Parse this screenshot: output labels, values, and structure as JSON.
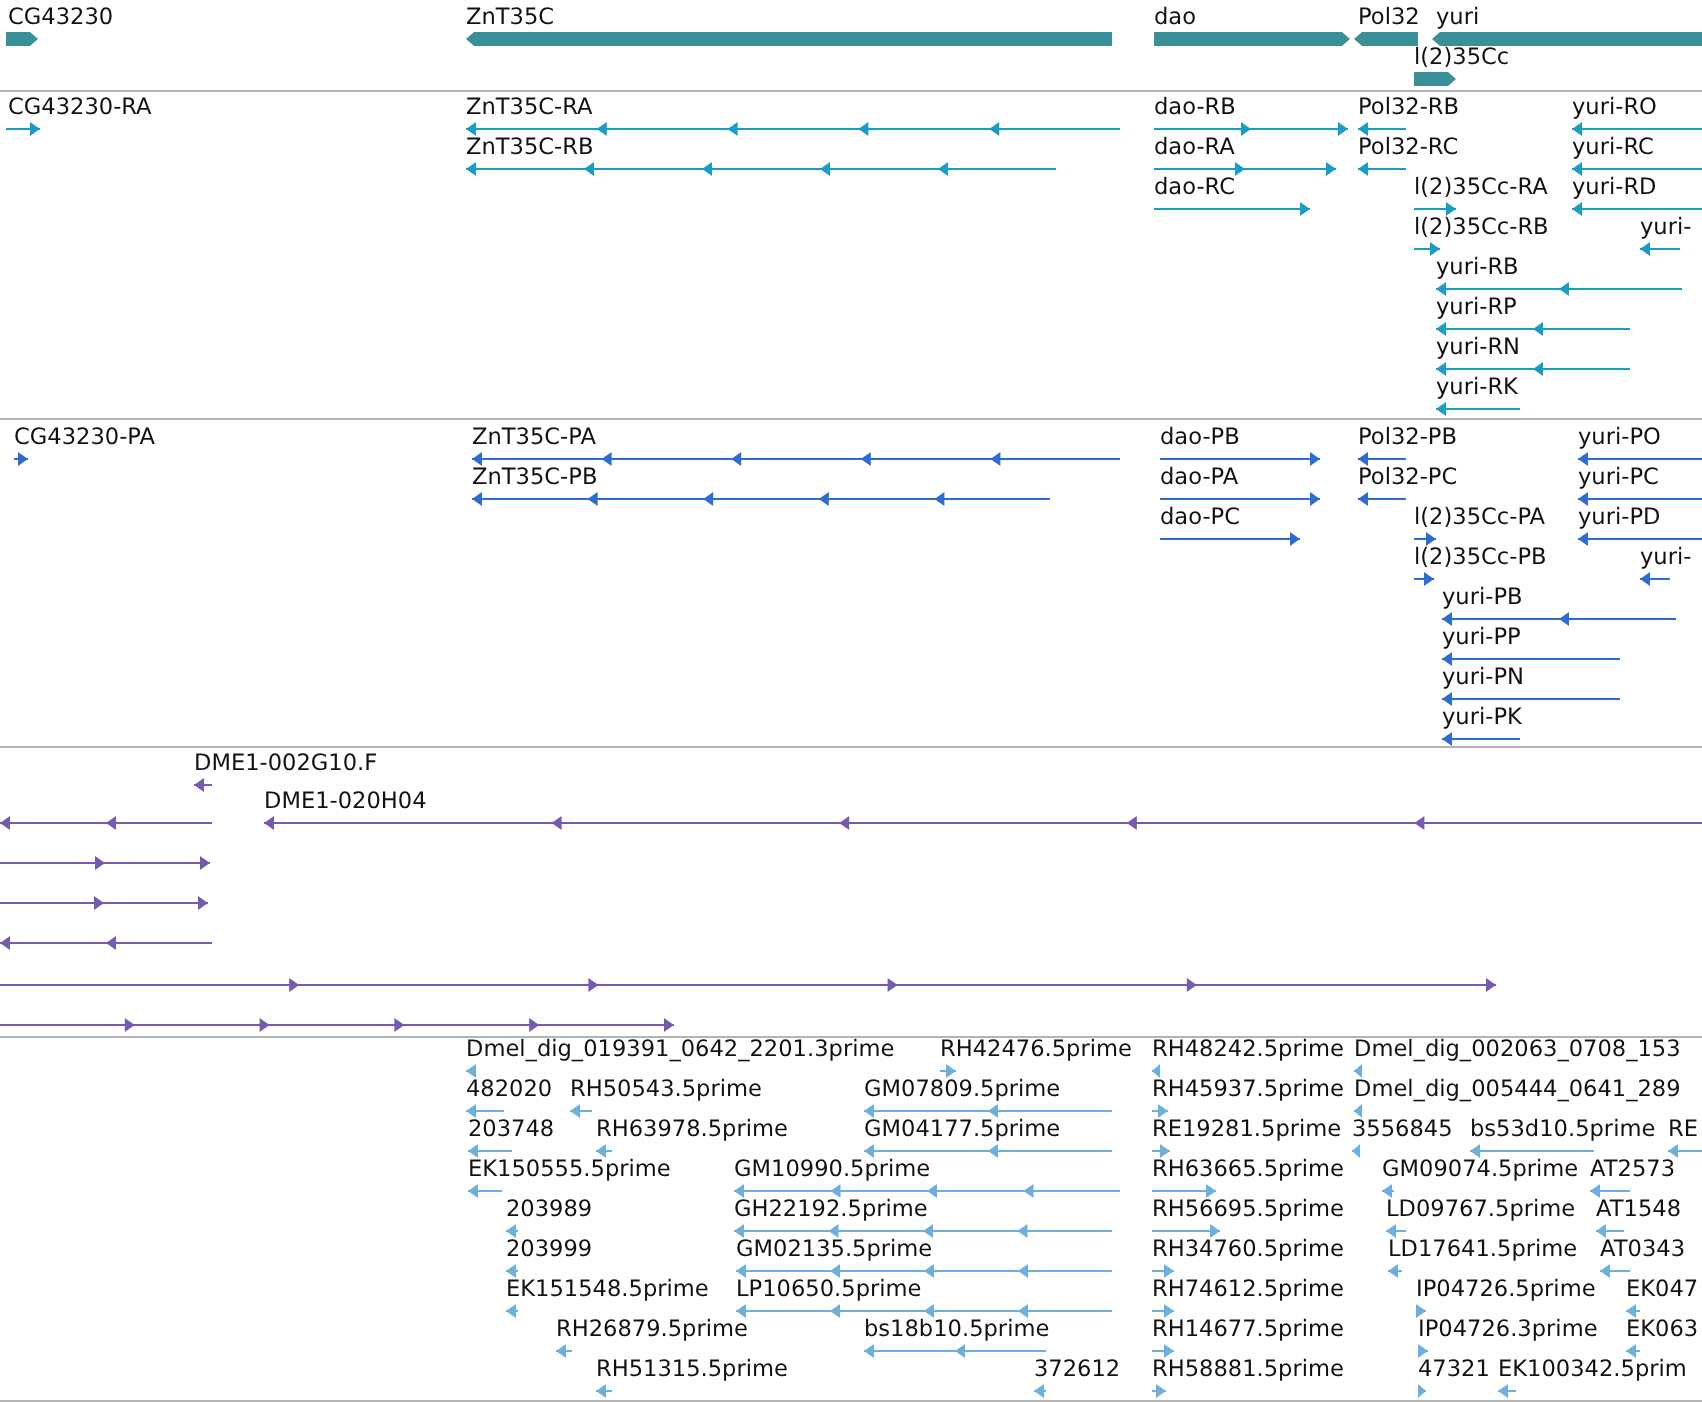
{
  "tracks": [
    {
      "kind": "gene",
      "color": "#3a9098",
      "features": [
        {
          "label": "CG43230",
          "reverse": false
        },
        {
          "label": "ZnT35C",
          "reverse": true
        },
        {
          "label": "dao",
          "reverse": false
        },
        {
          "label": "Pol32",
          "reverse": true
        },
        {
          "label": "yuri",
          "reverse": true
        },
        {
          "label": "l(2)35Cc",
          "reverse": false
        }
      ]
    },
    {
      "kind": "transcript",
      "color": "#1a9cc4",
      "features": [
        {
          "label": "CG43230-RA",
          "reverse": false
        },
        {
          "label": "ZnT35C-RA",
          "reverse": true
        },
        {
          "label": "ZnT35C-RB",
          "reverse": true
        },
        {
          "label": "dao-RB",
          "reverse": false
        },
        {
          "label": "dao-RA",
          "reverse": false
        },
        {
          "label": "dao-RC",
          "reverse": false
        },
        {
          "label": "Pol32-RB",
          "reverse": true
        },
        {
          "label": "Pol32-RC",
          "reverse": true
        },
        {
          "label": "l(2)35Cc-RA",
          "reverse": false
        },
        {
          "label": "l(2)35Cc-RB",
          "reverse": false
        },
        {
          "label": "yuri-RO",
          "reverse": true
        },
        {
          "label": "yuri-RC",
          "reverse": true
        },
        {
          "label": "yuri-RD",
          "reverse": true
        },
        {
          "label": "yuri-",
          "reverse": true
        },
        {
          "label": "yuri-RB",
          "reverse": true
        },
        {
          "label": "yuri-RP",
          "reverse": true
        },
        {
          "label": "yuri-RN",
          "reverse": true
        },
        {
          "label": "yuri-RK",
          "reverse": true
        }
      ]
    },
    {
      "kind": "protein",
      "color": "#2e6cd4",
      "features": [
        {
          "label": "CG43230-PA",
          "reverse": false
        },
        {
          "label": "ZnT35C-PA",
          "reverse": true
        },
        {
          "label": "ZnT35C-PB",
          "reverse": true
        },
        {
          "label": "dao-PB",
          "reverse": false
        },
        {
          "label": "dao-PA",
          "reverse": false
        },
        {
          "label": "dao-PC",
          "reverse": false
        },
        {
          "label": "Pol32-PB",
          "reverse": true
        },
        {
          "label": "Pol32-PC",
          "reverse": true
        },
        {
          "label": "l(2)35Cc-PA",
          "reverse": false
        },
        {
          "label": "l(2)35Cc-PB",
          "reverse": false
        },
        {
          "label": "yuri-PO",
          "reverse": true
        },
        {
          "label": "yuri-PC",
          "reverse": true
        },
        {
          "label": "yuri-PD",
          "reverse": true
        },
        {
          "label": "yuri-",
          "reverse": true
        },
        {
          "label": "yuri-PB",
          "reverse": true
        },
        {
          "label": "yuri-PP",
          "reverse": true
        },
        {
          "label": "yuri-PN",
          "reverse": true
        },
        {
          "label": "yuri-PK",
          "reverse": true
        }
      ]
    },
    {
      "kind": "clone",
      "color": "#7659b0",
      "features": [
        {
          "label": "DME1-002G10.F",
          "reverse": true
        },
        {
          "label": "DME1-020H04",
          "reverse": true
        },
        {
          "reverse": true
        },
        {
          "reverse": false
        },
        {
          "reverse": false
        },
        {
          "reverse": true
        },
        {
          "reverse": false
        },
        {
          "reverse": false
        }
      ]
    },
    {
      "kind": "est",
      "color": "#6cb0e0",
      "features": [
        {
          "label": "Dmel_dig_019391_0642_2201.3prime",
          "reverse": true
        },
        {
          "label": "RH42476.5prime",
          "reverse": false
        },
        {
          "label": "RH48242.5prime",
          "reverse": true
        },
        {
          "label": "Dmel_dig_002063_0708_153",
          "reverse": true
        },
        {
          "label": "482020",
          "reverse": true
        },
        {
          "label": "RH50543.5prime",
          "reverse": true
        },
        {
          "label": "GM07809.5prime",
          "reverse": true
        },
        {
          "label": "RH45937.5prime",
          "reverse": false
        },
        {
          "label": "Dmel_dig_005444_0641_289",
          "reverse": true
        },
        {
          "label": "203748",
          "reverse": true
        },
        {
          "label": "RH63978.5prime",
          "reverse": true
        },
        {
          "label": "GM04177.5prime",
          "reverse": true
        },
        {
          "label": "RE19281.5prime",
          "reverse": false
        },
        {
          "label": "3556845",
          "reverse": true
        },
        {
          "label": "bs53d10.5prime",
          "reverse": true
        },
        {
          "label": "RE",
          "reverse": true
        },
        {
          "label": "EK150555.5prime",
          "reverse": true
        },
        {
          "label": "GM10990.5prime",
          "reverse": true
        },
        {
          "label": "RH63665.5prime",
          "reverse": false
        },
        {
          "label": "GM09074.5prime",
          "reverse": true
        },
        {
          "label": "AT2573",
          "reverse": true
        },
        {
          "label": "203989",
          "reverse": true
        },
        {
          "label": "GH22192.5prime",
          "reverse": true
        },
        {
          "label": "RH56695.5prime",
          "reverse": false
        },
        {
          "label": "LD09767.5prime",
          "reverse": true
        },
        {
          "label": "AT1548",
          "reverse": true
        },
        {
          "label": "203999",
          "reverse": true
        },
        {
          "label": "GM02135.5prime",
          "reverse": true
        },
        {
          "label": "RH34760.5prime",
          "reverse": false
        },
        {
          "label": "LD17641.5prime",
          "reverse": true
        },
        {
          "label": "AT0343",
          "reverse": true
        },
        {
          "label": "EK151548.5prime",
          "reverse": true
        },
        {
          "label": "LP10650.5prime",
          "reverse": true
        },
        {
          "label": "RH74612.5prime",
          "reverse": false
        },
        {
          "label": "IP04726.5prime",
          "reverse": false
        },
        {
          "label": "EK047",
          "reverse": true
        },
        {
          "label": "RH26879.5prime",
          "reverse": true
        },
        {
          "label": "bs18b10.5prime",
          "reverse": true
        },
        {
          "label": "RH14677.5prime",
          "reverse": false
        },
        {
          "label": "IP04726.3prime",
          "reverse": false
        },
        {
          "label": "EK063",
          "reverse": true
        },
        {
          "label": "RH51315.5prime",
          "reverse": true
        },
        {
          "label": "372612",
          "reverse": true
        },
        {
          "label": "RH58881.5prime",
          "reverse": false
        },
        {
          "label": "47321",
          "reverse": false
        },
        {
          "label": "EK100342.5prim",
          "reverse": true
        }
      ]
    }
  ]
}
